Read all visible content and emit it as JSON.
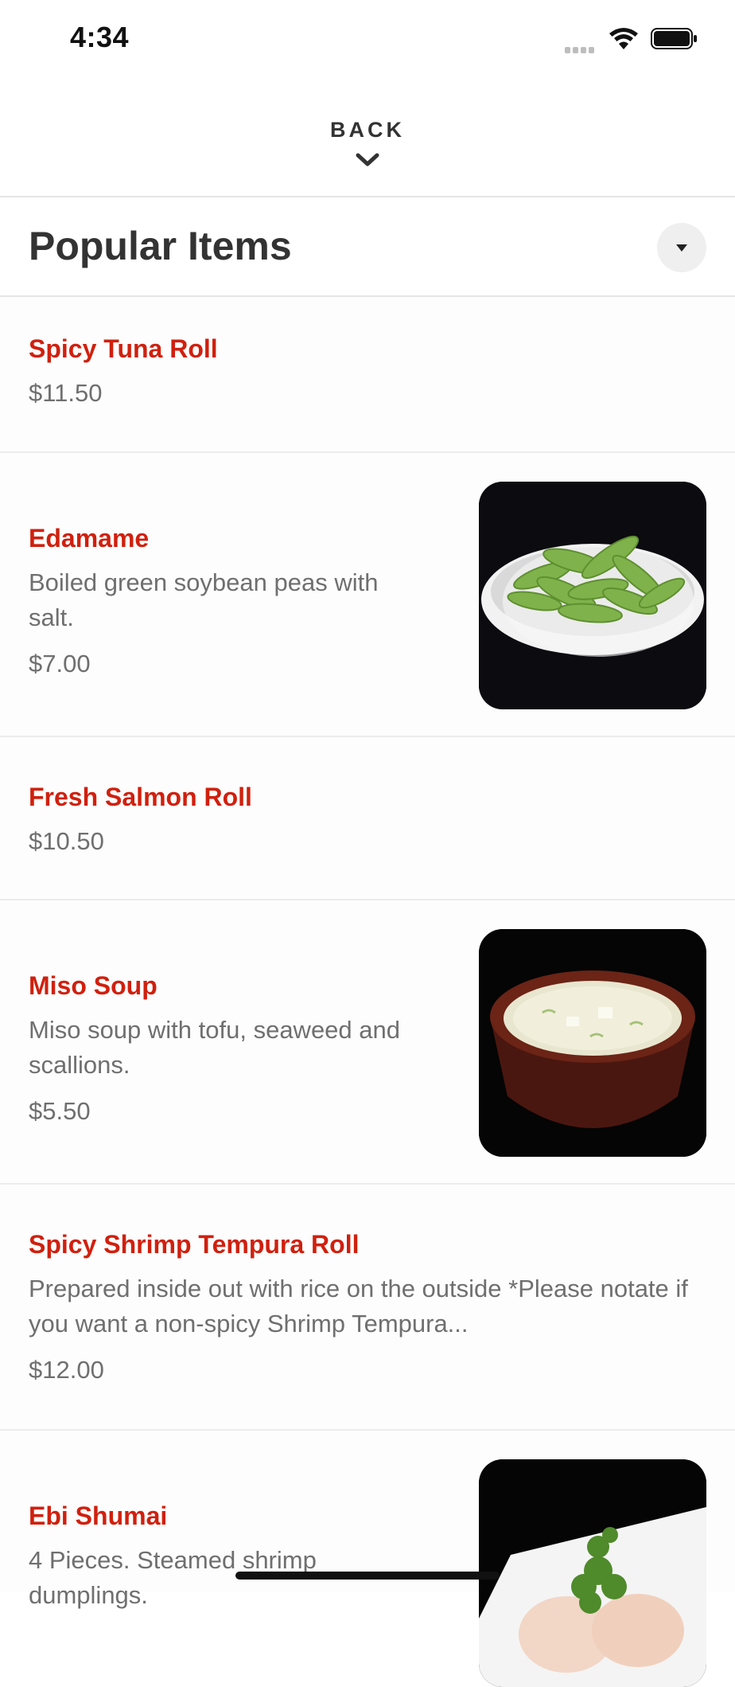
{
  "status": {
    "time": "4:34"
  },
  "nav": {
    "back_label": "BACK"
  },
  "section": {
    "title": "Popular Items"
  },
  "items": [
    {
      "name": "Spicy Tuna Roll",
      "description": "",
      "price": "$11.50",
      "image": ""
    },
    {
      "name": "Edamame",
      "description": "Boiled green soybean peas with salt.",
      "price": "$7.00",
      "image": "edamame-bowl"
    },
    {
      "name": "Fresh Salmon Roll",
      "description": "",
      "price": "$10.50",
      "image": ""
    },
    {
      "name": "Miso Soup",
      "description": "Miso soup with tofu, seaweed and scallions.",
      "price": "$5.50",
      "image": "miso-soup-bowl"
    },
    {
      "name": "Spicy Shrimp Tempura Roll",
      "description": "Prepared inside out with rice on the outside *Please notate if you want a non-spicy Shrimp Tempura...",
      "price": "$12.00",
      "image": ""
    },
    {
      "name": "Ebi Shumai",
      "description": "4 Pieces. Steamed shrimp dumplings.",
      "price": "",
      "image": "ebi-shumai-plate"
    }
  ],
  "colors": {
    "accent": "#d0200e",
    "text_secondary": "#6f6f6f",
    "title": "#333333"
  }
}
